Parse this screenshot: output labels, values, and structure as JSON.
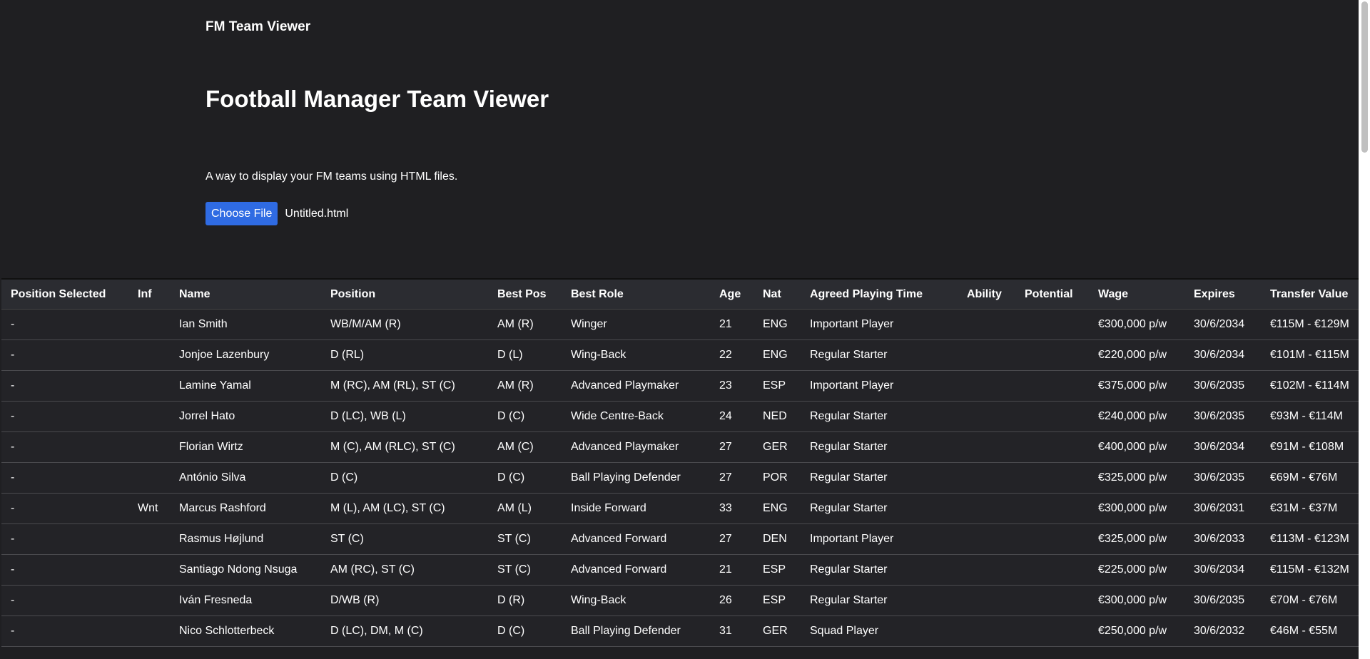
{
  "app_title": "FM Team Viewer",
  "heading": "Football Manager Team Viewer",
  "subtitle": "A way to display your FM teams using HTML files.",
  "file_input": {
    "button_label": "Choose File",
    "file_name": "Untitled.html"
  },
  "table": {
    "columns": [
      "Position Selected",
      "Inf",
      "Name",
      "Position",
      "Best Pos",
      "Best Role",
      "Age",
      "Nat",
      "Agreed Playing Time",
      "Ability",
      "Potential",
      "Wage",
      "Expires",
      "Transfer Value"
    ],
    "rows": [
      [
        "-",
        "",
        "Ian Smith",
        "WB/M/AM (R)",
        "AM (R)",
        "Winger",
        "21",
        "ENG",
        "Important Player",
        "",
        "",
        "€300,000 p/w",
        "30/6/2034",
        "€115M - €129M"
      ],
      [
        "-",
        "",
        "Jonjoe Lazenbury",
        "D (RL)",
        "D (L)",
        "Wing-Back",
        "22",
        "ENG",
        "Regular Starter",
        "",
        "",
        "€220,000 p/w",
        "30/6/2034",
        "€101M - €115M"
      ],
      [
        "-",
        "",
        "Lamine Yamal",
        "M (RC), AM (RL), ST (C)",
        "AM (R)",
        "Advanced Playmaker",
        "23",
        "ESP",
        "Important Player",
        "",
        "",
        "€375,000 p/w",
        "30/6/2035",
        "€102M - €114M"
      ],
      [
        "-",
        "",
        "Jorrel Hato",
        "D (LC), WB (L)",
        "D (C)",
        "Wide Centre-Back",
        "24",
        "NED",
        "Regular Starter",
        "",
        "",
        "€240,000 p/w",
        "30/6/2035",
        "€93M - €114M"
      ],
      [
        "-",
        "",
        "Florian Wirtz",
        "M (C), AM (RLC), ST (C)",
        "AM (C)",
        "Advanced Playmaker",
        "27",
        "GER",
        "Regular Starter",
        "",
        "",
        "€400,000 p/w",
        "30/6/2034",
        "€91M - €108M"
      ],
      [
        "-",
        "",
        "António Silva",
        "D (C)",
        "D (C)",
        "Ball Playing Defender",
        "27",
        "POR",
        "Regular Starter",
        "",
        "",
        "€325,000 p/w",
        "30/6/2035",
        "€69M - €76M"
      ],
      [
        "-",
        "Wnt",
        "Marcus Rashford",
        "M (L), AM (LC), ST (C)",
        "AM (L)",
        "Inside Forward",
        "33",
        "ENG",
        "Regular Starter",
        "",
        "",
        "€300,000 p/w",
        "30/6/2031",
        "€31M - €37M"
      ],
      [
        "-",
        "",
        "Rasmus Højlund",
        "ST (C)",
        "ST (C)",
        "Advanced Forward",
        "27",
        "DEN",
        "Important Player",
        "",
        "",
        "€325,000 p/w",
        "30/6/2033",
        "€113M - €123M"
      ],
      [
        "-",
        "",
        "Santiago Ndong Nsuga",
        "AM (RC), ST (C)",
        "ST (C)",
        "Advanced Forward",
        "21",
        "ESP",
        "Regular Starter",
        "",
        "",
        "€225,000 p/w",
        "30/6/2034",
        "€115M - €132M"
      ],
      [
        "-",
        "",
        "Iván Fresneda",
        "D/WB (R)",
        "D (R)",
        "Wing-Back",
        "26",
        "ESP",
        "Regular Starter",
        "",
        "",
        "€300,000 p/w",
        "30/6/2035",
        "€70M - €76M"
      ],
      [
        "-",
        "",
        "Nico Schlotterbeck",
        "D (LC), DM, M (C)",
        "D (C)",
        "Ball Playing Defender",
        "31",
        "GER",
        "Squad Player",
        "",
        "",
        "€250,000 p/w",
        "30/6/2032",
        "€46M - €55M"
      ]
    ]
  }
}
